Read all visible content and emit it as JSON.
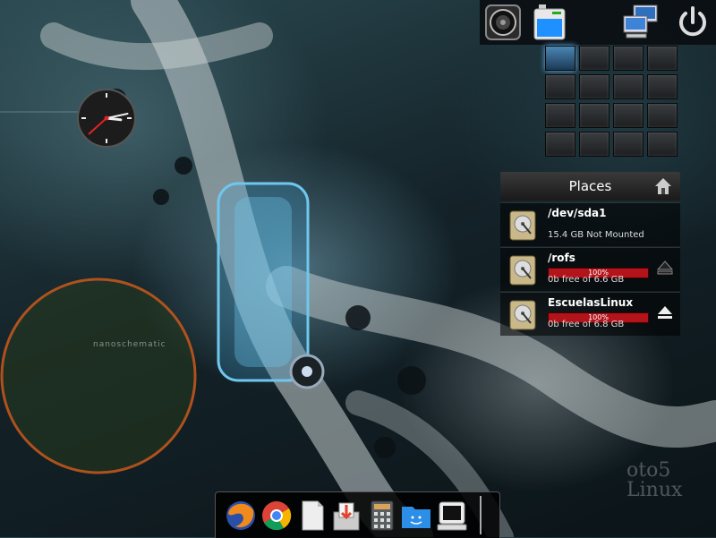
{
  "places": {
    "title": "Places",
    "items": [
      {
        "name": "/dev/sda1",
        "info": "15.4 GB Not Mounted"
      },
      {
        "name": "/rofs",
        "usage_percent": 100,
        "usage_label": "100%",
        "info": "0b free of 6.6 GB"
      },
      {
        "name": "EscuelasLinux",
        "usage_percent": 100,
        "usage_label": "100%",
        "info": "0b free of 6.8 GB"
      }
    ]
  },
  "workspaces": {
    "count": 16,
    "active_index": 0
  },
  "clock": {
    "hour": 3,
    "minute": 13,
    "second": 38
  },
  "dock": {
    "icons": [
      "firefox-icon",
      "chrome-icon",
      "text-editor-icon",
      "software-installer-icon",
      "calculator-icon",
      "file-manager-icon",
      "terminal-icon"
    ]
  },
  "watermark": {
    "line1": "oto5",
    "line2": "Linux"
  },
  "desktop_label": "nanoschematic",
  "colors": {
    "usage_bar": "#b3141b",
    "active_workspace": "#4b86b4"
  }
}
